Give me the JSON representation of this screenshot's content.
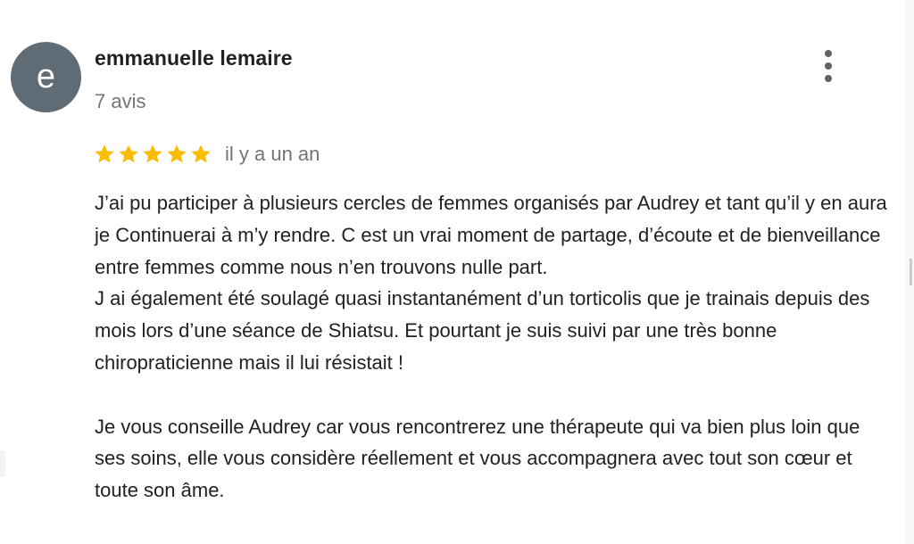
{
  "review": {
    "avatar_letter": "e",
    "avatar_color": "#5f6c75",
    "reviewer_name": "emmanuelle lemaire",
    "review_count": "7 avis",
    "rating": 5,
    "rating_max": 5,
    "star_color": "#fbbc04",
    "date": "il y a un an",
    "text": "J’ai pu participer à plusieurs cercles de femmes organisés par Audrey et tant qu’il y en aura je Continuerai à m’y rendre. C est un vrai moment de partage, d’écoute et de bienveillance entre femmes comme nous n’en trouvons nulle part.\nJ ai également été soulagé quasi instantanément d’un torticolis que je trainais depuis des mois lors d’une séance de Shiatsu. Et pourtant je suis suivi par une très bonne chiropraticienne mais il lui résistait !\n\nJe vous conseille Audrey car vous rencontrerez une thérapeute qui va bien plus loin que ses soins, elle vous considère réellement et vous accompagnera avec tout son cœur et toute son âme.",
    "menu_icon": "more-vert-icon"
  }
}
